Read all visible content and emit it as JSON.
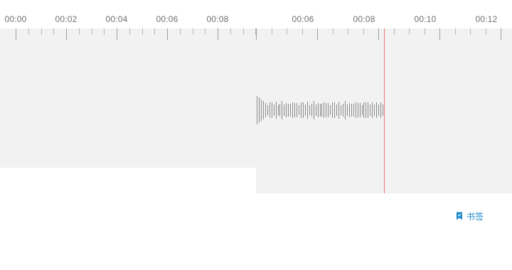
{
  "timeline_left": {
    "labels": [
      "00:00",
      "00:02",
      "00:04",
      "00:06",
      "00:08"
    ]
  },
  "timeline_right": {
    "labels": [
      "00:06",
      "00:08",
      "00:10",
      "00:12"
    ]
  },
  "playhead_time": "00:08",
  "colors": {
    "track_background": "#f2f2f2",
    "playhead": "#f0796d",
    "waveform": "#8a8a8a",
    "accent": "#1e88c9"
  },
  "toolbar": {
    "bookmark_label": "书签",
    "bookmark_icon": "bookmark-icon"
  }
}
